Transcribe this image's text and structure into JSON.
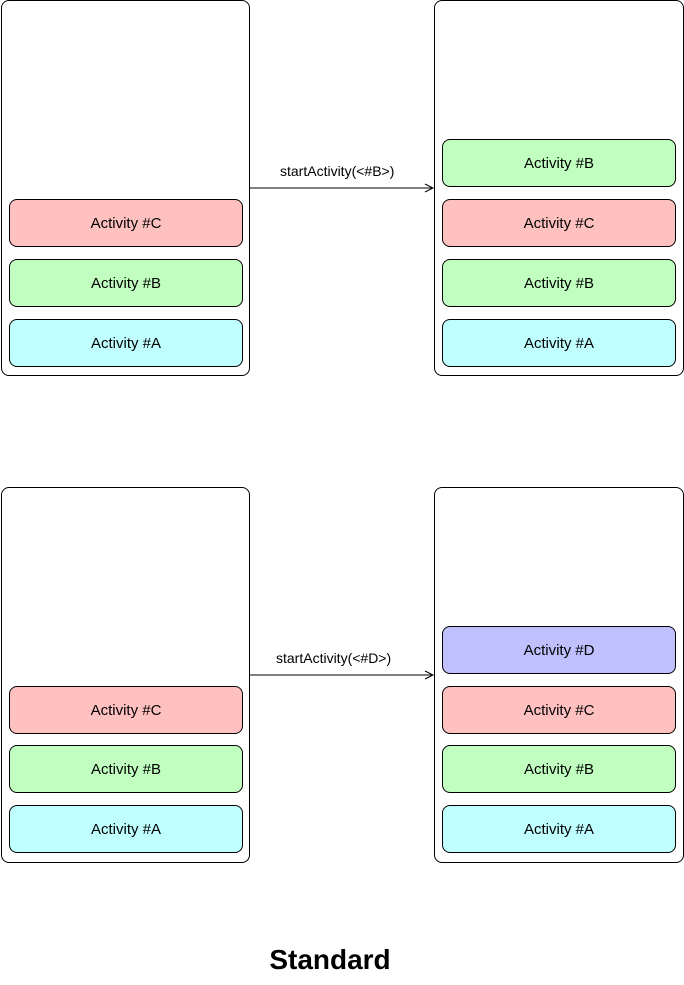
{
  "colors": {
    "A": "#c0ffff",
    "B": "#c0ffc0",
    "C": "#ffc0c0",
    "D": "#c0c0ff"
  },
  "rows": [
    {
      "before": [
        {
          "label": "Activity #C",
          "key": "C"
        },
        {
          "label": "Activity #B",
          "key": "B"
        },
        {
          "label": "Activity #A",
          "key": "A"
        }
      ],
      "action": "startActivity(<#B>)",
      "after": [
        {
          "label": "Activity #B",
          "key": "B"
        },
        {
          "label": "Activity #C",
          "key": "C"
        },
        {
          "label": "Activity #B",
          "key": "B"
        },
        {
          "label": "Activity #A",
          "key": "A"
        }
      ]
    },
    {
      "before": [
        {
          "label": "Activity #C",
          "key": "C"
        },
        {
          "label": "Activity #B",
          "key": "B"
        },
        {
          "label": "Activity #A",
          "key": "A"
        }
      ],
      "action": "startActivity(<#D>)",
      "after": [
        {
          "label": "Activity #D",
          "key": "D"
        },
        {
          "label": "Activity #C",
          "key": "C"
        },
        {
          "label": "Activity #B",
          "key": "B"
        },
        {
          "label": "Activity #A",
          "key": "A"
        }
      ]
    }
  ],
  "title": "Standard"
}
